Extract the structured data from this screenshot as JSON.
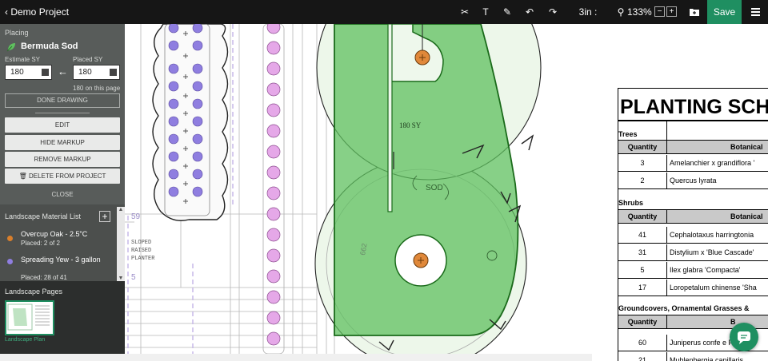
{
  "topbar": {
    "back_label": "Demo Project",
    "scale": "3in : 30ft",
    "zoom": "133%",
    "zoom_out": "−",
    "zoom_in": "+",
    "save_label": "Save",
    "tools": [
      "scissors-icon",
      "text-icon",
      "pen-icon",
      "undo-icon",
      "redo-icon"
    ]
  },
  "sidebar": {
    "placing_label": "Placing",
    "material": "Bermuda Sod",
    "estimate_label": "Estimate SY",
    "estimate_value": "180",
    "placed_label": "Placed SY",
    "placed_value": "180",
    "on_page": "180 on this page",
    "done_drawing": "DONE DRAWING",
    "edit": "EDIT",
    "hide_markup": "HIDE MARKUP",
    "remove_markup": "REMOVE MARKUP",
    "delete_from_project": "DELETE FROM PROJECT",
    "close": "CLOSE"
  },
  "material_list": {
    "header": "Landscape Material List",
    "add": "+",
    "items": [
      {
        "name": "Overcup Oak - 2.5\"C",
        "placed": "Placed: 2 of 2",
        "color": "#d97f2b"
      },
      {
        "name": "Spreading Yew - 3 gallon",
        "placed": "Placed: 28 of 41",
        "color": "#8f7ee0"
      }
    ]
  },
  "pages": {
    "header": "Landscape Pages",
    "items": [
      {
        "label": "Landscape Plan"
      }
    ]
  },
  "plan": {
    "area_label": "180 SY",
    "sod_label": "SOD",
    "sloped_note": [
      "SLOPED",
      "RAISED",
      "PLANTER"
    ],
    "number_label": "662",
    "sod_color": "#5fc05f",
    "tree_color": "#e0883a"
  },
  "schedule": {
    "title": "PLANTING SCH",
    "sections": [
      {
        "name": "Trees",
        "qty_header": "Quantity",
        "name_header": "Botanical",
        "rows": [
          {
            "q": "3",
            "b": "Amelanchier x grandiflora '"
          },
          {
            "q": "2",
            "b": "Quercus lyrata"
          }
        ]
      },
      {
        "name": "Shrubs",
        "qty_header": "Quantity",
        "name_header": "Botanical",
        "rows": [
          {
            "q": "41",
            "b": "Cephalotaxus harringtonia"
          },
          {
            "q": "31",
            "b": "Distylium x 'Blue Cascade'"
          },
          {
            "q": "5",
            "b": "Ilex glabra 'Compacta'"
          },
          {
            "q": "17",
            "b": "Loropetalum chinense 'Sha"
          }
        ]
      },
      {
        "name": "Groundcovers, Ornamental Grasses &",
        "qty_header": "Quantity",
        "name_header": "B",
        "rows": [
          {
            "q": "60",
            "b": "Juniperus confe     e P"
          },
          {
            "q": "21",
            "b": "Muhlenbergia capillaris"
          }
        ]
      }
    ]
  }
}
